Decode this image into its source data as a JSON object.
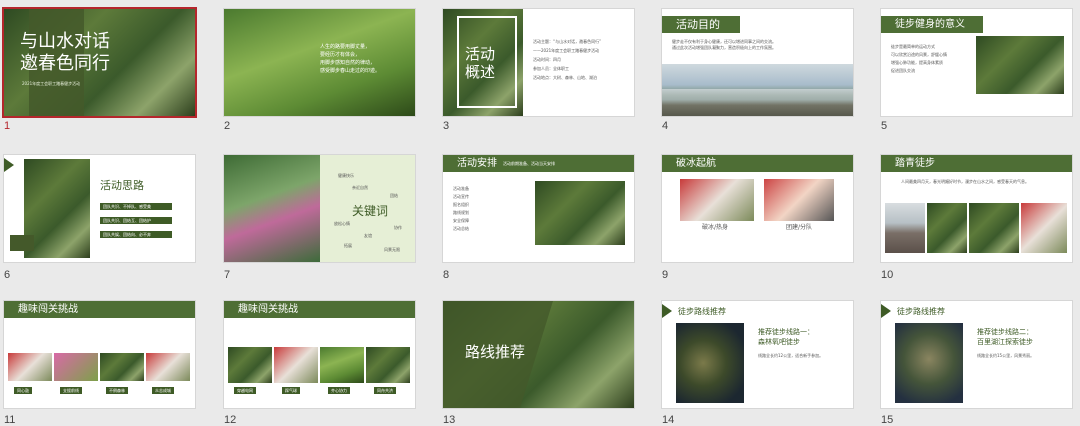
{
  "slides": [
    {
      "num": "1",
      "title_line1": "与山水对话",
      "title_line2": "邀春色同行",
      "subtitle": "2021年度工会职工踏春健步活动"
    },
    {
      "num": "2",
      "lines": [
        "人生的路要用脚丈量，",
        "要经历才有体会，",
        "用脚步感知自然的律动，",
        "感受脚步春山走过的印迹。"
      ]
    },
    {
      "num": "3",
      "title_a": "活动",
      "title_b": "概述",
      "items": [
        "活动主题：“与山水对话，邀春色同行”",
        "——2021年度工会职工踏春健步活动",
        "活动时间：四月",
        "参加人员：全体职工",
        "活动地点：大树、森林、山地、湖泊"
      ]
    },
    {
      "num": "4",
      "heading": "活动目的",
      "lines": [
        "健步走不仅有利于身心健康，还可以增进同事之间的交流。",
        "通过此次活动增强团队凝聚力，营造积极向上的工作氛围。"
      ]
    },
    {
      "num": "5",
      "heading": "徒步健身的意义",
      "lines": [
        "徒步是最简单的运动方式",
        "可以欣赏沿途的风景，舒缓心情",
        "增强心肺功能，提高身体素质",
        "促进团队交流"
      ]
    },
    {
      "num": "6",
      "heading": "活动思路",
      "tags": [
        "团队共识、不掉队、感受美",
        "团队共识、团结互、团结护",
        "团队共娱、团结向、必不弃"
      ]
    },
    {
      "num": "7",
      "heading": "关键词",
      "words": [
        "健康快乐",
        "亲近自然",
        "团结",
        "协作",
        "放松心情",
        "友谊",
        "拓展",
        "风景无限"
      ]
    },
    {
      "num": "8",
      "heading": "活动安排",
      "note": "活动前期准备、活动当天安排",
      "items": [
        "活动准备",
        "活动宣传",
        "报名组织",
        "路线规划",
        "安全保障",
        "活动总结"
      ]
    },
    {
      "num": "9",
      "heading": "破冰起航",
      "captions": [
        "破冰/热身",
        "团建/分队"
      ]
    },
    {
      "num": "10",
      "heading": "踏青徒步",
      "desc": "人间最美四月天，春光明媚好时节，漫步在山水之间，感受春天的气息。"
    },
    {
      "num": "11",
      "heading": "趣味闯关挑战",
      "badges": [
        "同心鼓",
        "支援前线",
        "不倒森林",
        "众志成城"
      ]
    },
    {
      "num": "12",
      "heading": "趣味闯关挑战",
      "badges": [
        "穿越电网",
        "踩气球",
        "齐心协力",
        "同舟共济"
      ]
    },
    {
      "num": "13",
      "heading": "路线推荐"
    },
    {
      "num": "14",
      "heading": "徒步路线推荐",
      "route_title": "推荐徒步线路一：",
      "route_name": "森林氧吧徒步",
      "desc": "线路全长约12公里，适合新手参加。"
    },
    {
      "num": "15",
      "heading": "徒步路线推荐",
      "route_title": "推荐徒步线路二：",
      "route_name": "百里湖江探索徒步",
      "desc": "线路全长约15公里，风景秀丽。"
    }
  ]
}
